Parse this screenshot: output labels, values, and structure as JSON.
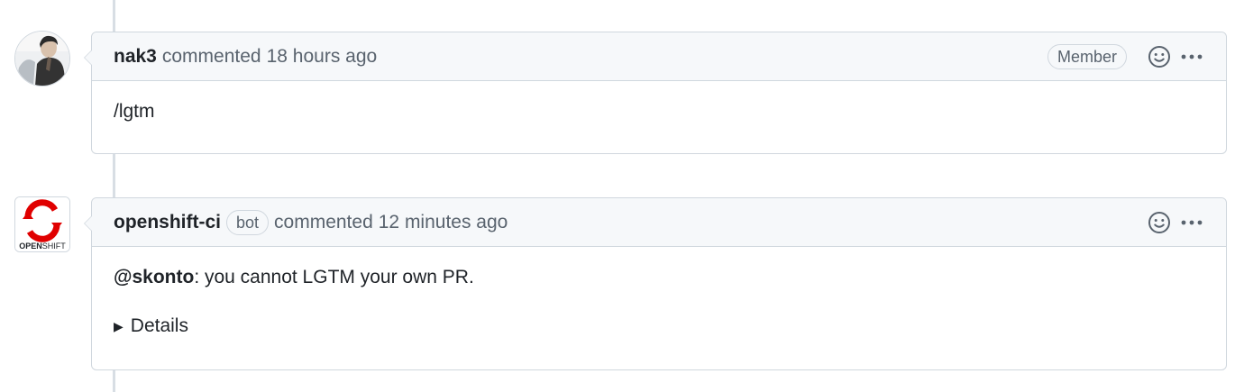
{
  "comments": [
    {
      "author": "nak3",
      "action": "commented",
      "time": "18 hours ago",
      "badge": "Member",
      "body": "/lgtm",
      "avatar_icon": "user-avatar-photo"
    },
    {
      "author": "openshift-ci",
      "bot_label": "bot",
      "action": "commented",
      "time": "12 minutes ago",
      "mention": "@skonto",
      "body": ": you cannot LGTM your own PR.",
      "details_label": "Details",
      "avatar_icon": "openshift-logo",
      "avatar_text_bold": "OPEN",
      "avatar_text_light": "SHIFT"
    }
  ],
  "colors": {
    "border": "#d0d7de",
    "header_bg": "#f6f8fa",
    "muted_text": "#59636e",
    "openshift_red": "#e00000"
  }
}
